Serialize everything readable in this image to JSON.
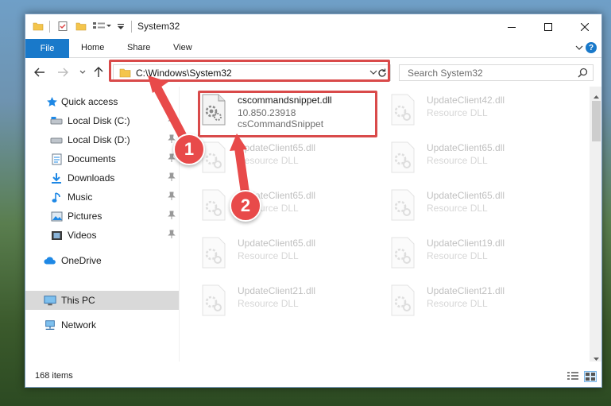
{
  "window": {
    "title": "System32",
    "accent": "#1979ca"
  },
  "ribbon": {
    "tabs": [
      "File",
      "Home",
      "Share",
      "View"
    ],
    "help": "?"
  },
  "address": {
    "path": "C:\\Windows\\System32"
  },
  "search": {
    "placeholder": "Search System32"
  },
  "sidebar": {
    "items": [
      {
        "label": "Quick access",
        "icon": "star-icon"
      },
      {
        "label": "Local Disk (C:)",
        "icon": "drive-icon",
        "pinned": true
      },
      {
        "label": "Local Disk (D:)",
        "icon": "drive-icon",
        "pinned": true
      },
      {
        "label": "Documents",
        "icon": "documents-icon",
        "pinned": true
      },
      {
        "label": "Downloads",
        "icon": "download-icon",
        "pinned": true
      },
      {
        "label": "Music",
        "icon": "music-icon",
        "pinned": true
      },
      {
        "label": "Pictures",
        "icon": "pictures-icon",
        "pinned": true
      },
      {
        "label": "Videos",
        "icon": "videos-icon",
        "pinned": true
      },
      {
        "label": "OneDrive",
        "icon": "cloud-icon"
      },
      {
        "label": "This PC",
        "icon": "computer-icon",
        "selected": true
      },
      {
        "label": "Network",
        "icon": "network-icon"
      }
    ]
  },
  "files": {
    "highlighted": {
      "name": "cscommandsnippet.dll",
      "version": "10.850.23918",
      "description": "csCommandSnippet"
    },
    "tiles": [
      {
        "name": "UpdateClient42.dll",
        "type": "Resource DLL"
      },
      {
        "name": "UpdateClient65.dll",
        "type": "Resource DLL"
      },
      {
        "name": "UpdateClient65.dll",
        "type": "Resource DLL"
      },
      {
        "name": "UpdateClient65.dll",
        "type": "Resource DLL"
      },
      {
        "name": "UpdateClient65.dll",
        "type": "Resource DLL"
      },
      {
        "name": "UpdateClient65.dll",
        "type": "Resource DLL"
      },
      {
        "name": "UpdateClient19.dll",
        "type": "Resource DLL"
      },
      {
        "name": "UpdateClient21.dll",
        "type": "Resource DLL"
      },
      {
        "name": "UpdateClient21.dll",
        "type": "Resource DLL"
      }
    ]
  },
  "status": {
    "item_count": "168 items"
  },
  "annotations": {
    "step1": "1",
    "step2": "2",
    "color": "#e84a4a"
  }
}
